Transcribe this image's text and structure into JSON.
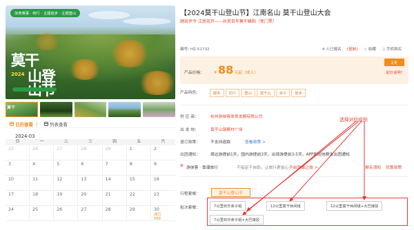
{
  "hero": {
    "tag": "体育赛事 · 莳行 · 主题徒步 · 主题登山",
    "logo_line1": "莫干",
    "logo_line2": "山登山节",
    "logo_year": "2024"
  },
  "thumbnails": [
    {
      "label": "莫干"
    },
    {
      "label": ""
    },
    {
      "label": ""
    },
    {
      "label": ""
    },
    {
      "label": ""
    }
  ],
  "view_tabs": {
    "calendar": "日历查看",
    "list": "列表查看"
  },
  "calendar": {
    "month": "2024-03",
    "weekdays": [
      "日",
      "一",
      "二",
      "三",
      "四",
      "五",
      "六"
    ],
    "weeks": [
      [
        "",
        "",
        "",
        "",
        "",
        "1",
        "2"
      ],
      [
        "25",
        "26",
        "27",
        "28",
        "29",
        "1",
        "2"
      ],
      [
        "3",
        "4",
        "5",
        "6",
        "7",
        "8",
        "9"
      ],
      [
        "10",
        "11",
        "12",
        "13",
        "14",
        "15",
        "16"
      ],
      [
        "17",
        "18",
        "19",
        "20",
        "21",
        "22",
        "23"
      ],
      [
        "24",
        "25",
        "26",
        "27",
        "28",
        "29",
        "30"
      ]
    ],
    "stock_note": {
      "line1": "成行",
      "line2": "¥88"
    }
  },
  "product": {
    "title": "【2024莫干山登山节】江南名山 莫干山登山大会",
    "subtitle": "踏去步今 江南花开——共赏百年莫干峰韵（免门票）",
    "code_label": "编号: HZ-51732",
    "count_label": "4 人已报名",
    "copy_link": "[复制]",
    "favorite": "收藏",
    "mobile_order": "手机购买",
    "price_label": "产品价格：",
    "currency": "¥",
    "price": "88",
    "price_unit": "元起（成人）",
    "days_badge": "1天",
    "start_link": "起价说明？",
    "features_label": "产品特色：",
    "features": [
      "服务",
      "初行",
      "登山",
      "莫干山",
      "亲子",
      "徒步"
    ]
  },
  "details": {
    "organizer": {
      "label": "供 应 商：",
      "value": "杭州游侠客体育发展有限公司"
    },
    "departure": {
      "label": "出 发 地：",
      "value": "莫干山镇蔡村广场"
    },
    "refund": {
      "label": "退订政策：",
      "value": "不支持退款",
      "link": "查看政策 >"
    },
    "notice": {
      "label": "出团通知：",
      "value": "周边游提前1天，国内游提前3天，出境游提前3-5天，APP和短信群发出团通知"
    },
    "guarantee": {
      "label": "游侠客 · 靠谱旅行",
      "value": "不指定不自助，让旅行更省心",
      "link": "开启靠谱之旅 >",
      "extra1": "报名须知",
      "extra2": "优惠政策"
    }
  },
  "annotation": "选择对应组别",
  "booking": {
    "package_label": "行程套餐：",
    "package_value": "莫干山登山节",
    "batch_label": "批次套餐：",
    "options": [
      "7公里欢乐亲子组",
      "12公里莫干休闲组",
      "12公里莫干休闲组+大巴接驳",
      "7公里欢乐亲子组+大巴接驳"
    ]
  },
  "colors": {
    "accent": "#f08c1e",
    "price_bg": "#fdf1e4",
    "highlight": "#e53935",
    "brand_green": "#2c9a45"
  }
}
